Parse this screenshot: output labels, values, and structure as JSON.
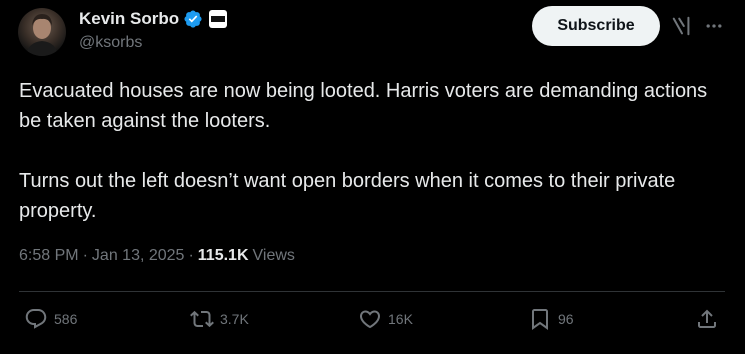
{
  "author": {
    "name": "Kevin Sorbo",
    "handle": "@ksorbs"
  },
  "header": {
    "subscribe_label": "Subscribe"
  },
  "tweet": {
    "text": "Evacuated houses are now being looted. Harris voters are demanding actions be taken against the looters.\n\nTurns out the left doesn’t want open borders when it comes to their private property."
  },
  "meta": {
    "time": "6:58 PM",
    "sep1": "·",
    "date": "Jan 13, 2025",
    "sep2": "·",
    "views_count": "115.1K",
    "views_label": "Views"
  },
  "actions": {
    "replies": "586",
    "reposts": "3.7K",
    "likes": "16K",
    "bookmarks": "96"
  },
  "colors": {
    "background": "#000000",
    "text": "#e7e9ea",
    "muted": "#71767b",
    "verified": "#1d9bf0",
    "divider": "#2f3336"
  },
  "icons": [
    "verified-badge-icon",
    "affiliate-badge-icon",
    "grok-icon",
    "more-icon",
    "reply-icon",
    "retweet-icon",
    "like-icon",
    "bookmark-icon",
    "share-icon"
  ]
}
